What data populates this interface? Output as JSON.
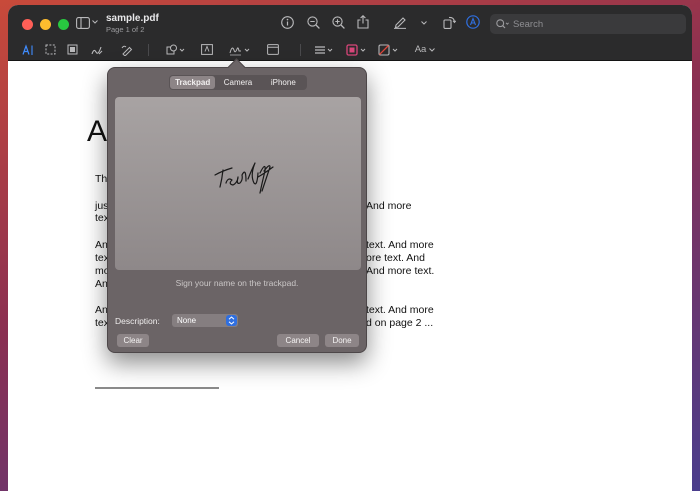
{
  "window": {
    "title": "sample.pdf",
    "subtitle": "Page 1 of 2"
  },
  "toolbar": {
    "search_placeholder": "Search",
    "icons": [
      "sidebar-icon",
      "chevron-down-icon",
      "info-icon",
      "zoom-out-icon",
      "zoom-in-icon",
      "share-icon",
      "highlight-pen-icon",
      "chevron-down-icon",
      "rotate-icon",
      "markup-icon",
      "search-icon"
    ]
  },
  "markup_bar": {
    "icons": [
      "text-selection-icon",
      "rectangle-selection-icon",
      "redact-icon",
      "sketch-icon",
      "draw-icon",
      "shapes-icon",
      "text-box-icon",
      "sign-icon",
      "note-icon",
      "line-style-icon",
      "border-color-icon",
      "fill-color-icon",
      "text-style-icon"
    ],
    "text_style_label": "Aa"
  },
  "document": {
    "heading": "A",
    "lines": [
      "Th",
      "jus",
      "tex",
      "An",
      "tex",
      "mo",
      "An",
      "An",
      "tex"
    ],
    "right_lines": [
      "And more",
      "text. And more",
      "ore text. And",
      "And more text.",
      "text. And more",
      "d on page 2 ..."
    ]
  },
  "signature_popover": {
    "tabs": [
      "Trackpad",
      "Camera",
      "iPhone"
    ],
    "active_tab": "Trackpad",
    "hint": "Sign your name on the trackpad.",
    "description_label": "Description:",
    "description_value": "None",
    "clear_label": "Clear",
    "cancel_label": "Cancel",
    "done_label": "Done"
  },
  "colors": {
    "titlebar": "#2b2b2c",
    "popover": "#6b6466",
    "accent": "#2f6fe0"
  }
}
